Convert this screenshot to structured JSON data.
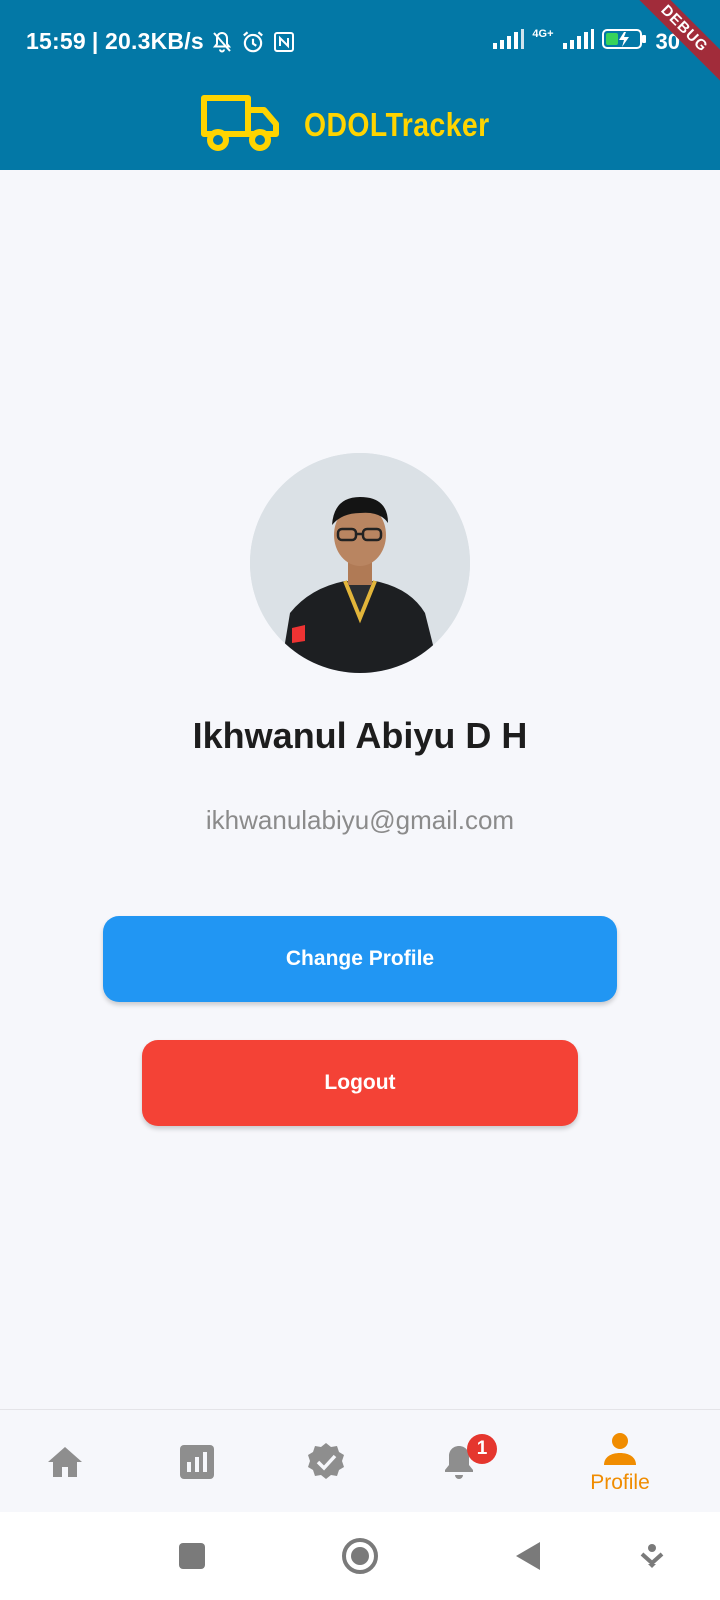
{
  "status_bar": {
    "time": "15:59",
    "speed": "| 20.3KB/s",
    "network": "4G+",
    "battery": "30",
    "debug": "DEBUG"
  },
  "app_bar": {
    "title": "ODOLTracker",
    "logo_icon": "truck-icon",
    "title_color": "#ffd400",
    "background": "#0378a6"
  },
  "profile": {
    "name": "Ikhwanul Abiyu D H",
    "email": "ikhwanulabiyu@gmail.com",
    "avatar_icon": "user-photo"
  },
  "actions": {
    "change_profile": "Change Profile",
    "change_profile_color": "#2196f3",
    "logout": "Logout",
    "logout_color": "#f44236"
  },
  "bottom_nav": {
    "items": [
      {
        "icon": "home-icon",
        "label": ""
      },
      {
        "icon": "bar-chart-icon",
        "label": ""
      },
      {
        "icon": "verified-badge-icon",
        "label": ""
      },
      {
        "icon": "bell-icon",
        "label": "",
        "badge": "1"
      },
      {
        "icon": "person-icon",
        "label": "Profile",
        "active": true
      }
    ],
    "active_color": "#f08c00",
    "inactive_color": "#8e8e8e"
  },
  "system_nav": {
    "buttons": [
      "recents-square-icon",
      "home-circle-icon",
      "back-triangle-icon",
      "assistant-icon"
    ]
  }
}
